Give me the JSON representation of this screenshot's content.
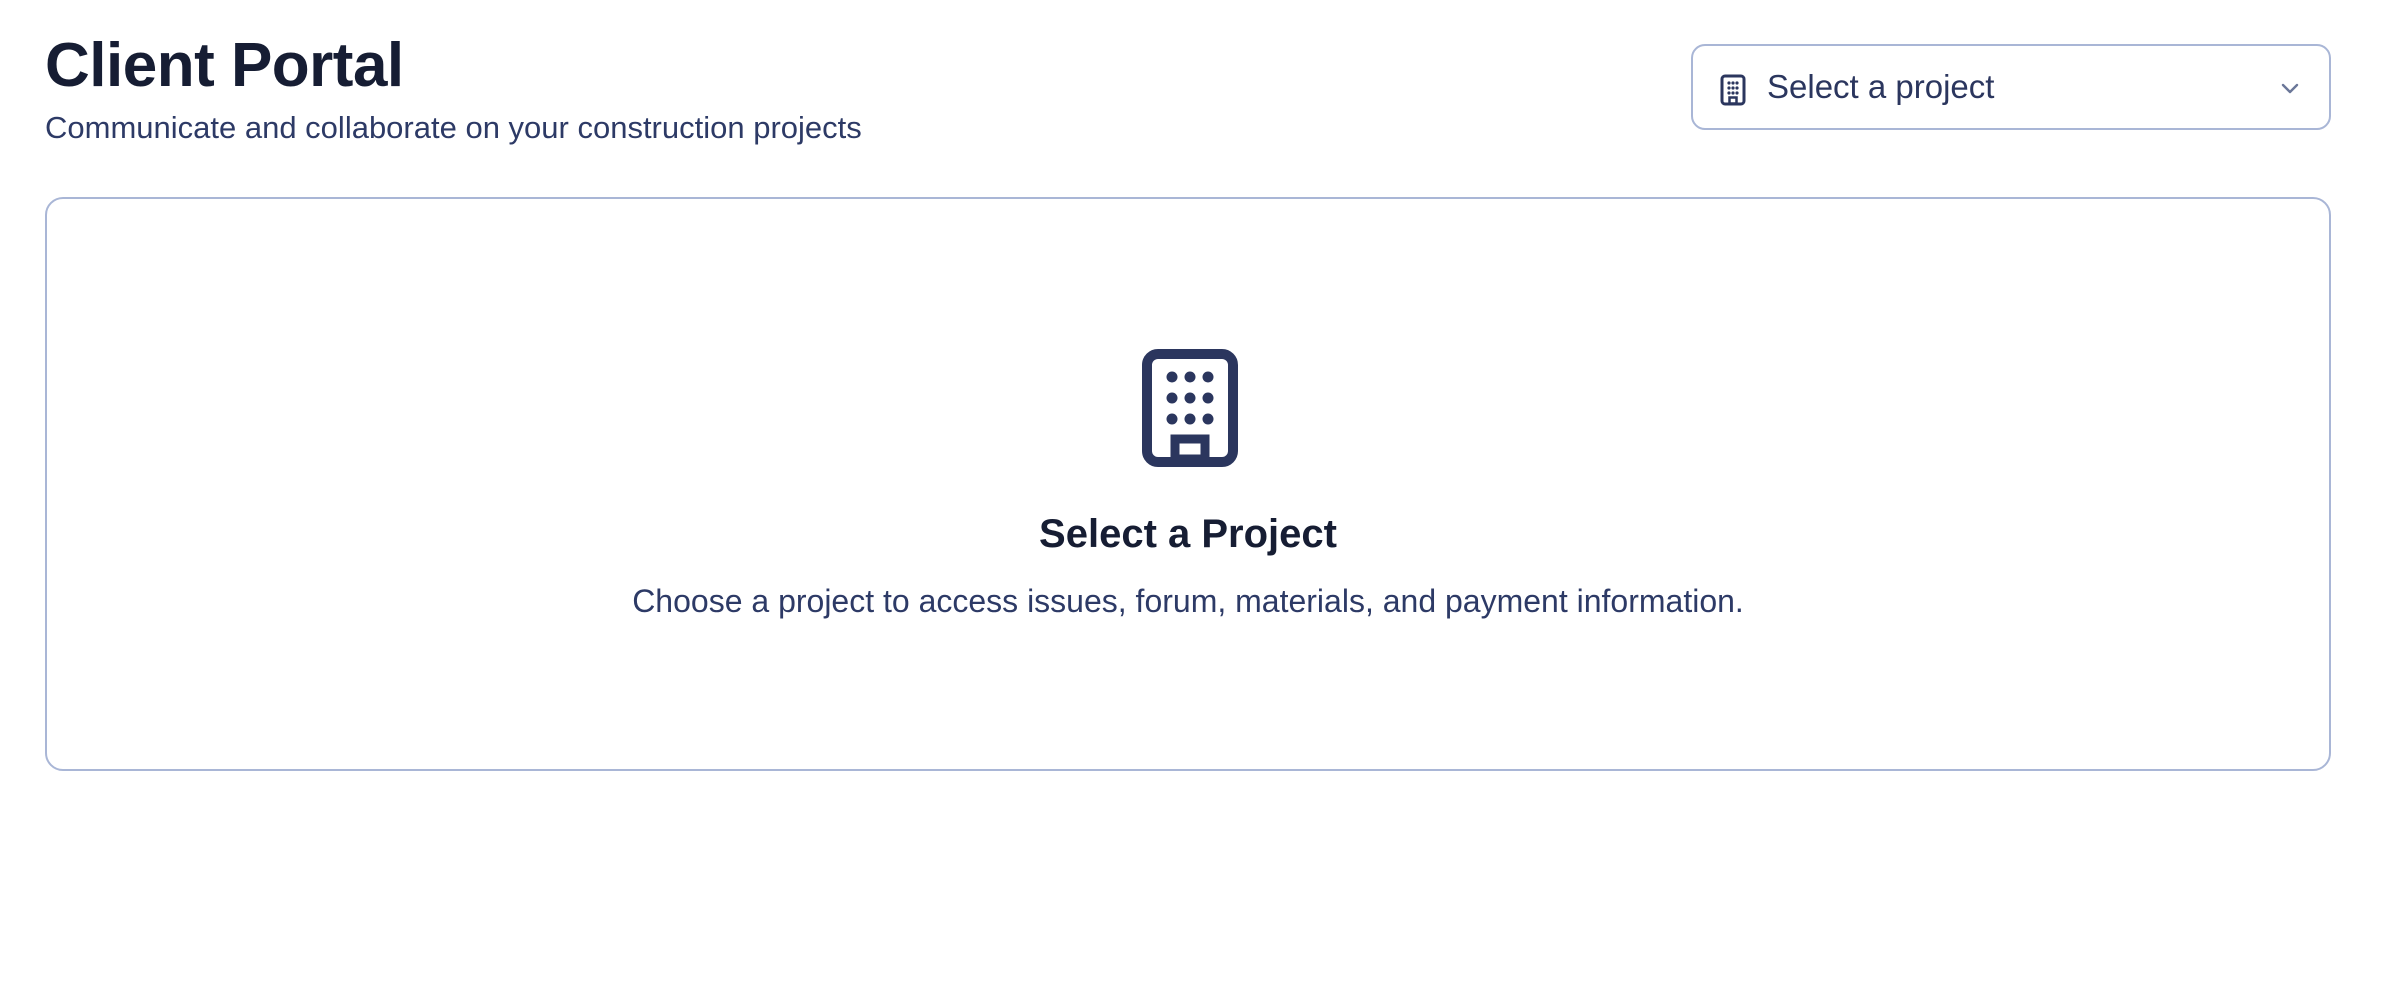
{
  "header": {
    "title": "Client Portal",
    "subtitle": "Communicate and collaborate on your construction projects"
  },
  "project_select": {
    "placeholder": "Select a project",
    "icon": "building-icon",
    "toggle_icon": "chevron-down-icon"
  },
  "empty_state": {
    "icon": "building-icon",
    "title": "Select a Project",
    "description": "Choose a project to access issues, forum, materials, and payment information."
  },
  "colors": {
    "heading": "#161d33",
    "text": "#2d3a66",
    "border": "#a9b6d6",
    "icon": "#2b365e",
    "background": "#ffffff"
  }
}
